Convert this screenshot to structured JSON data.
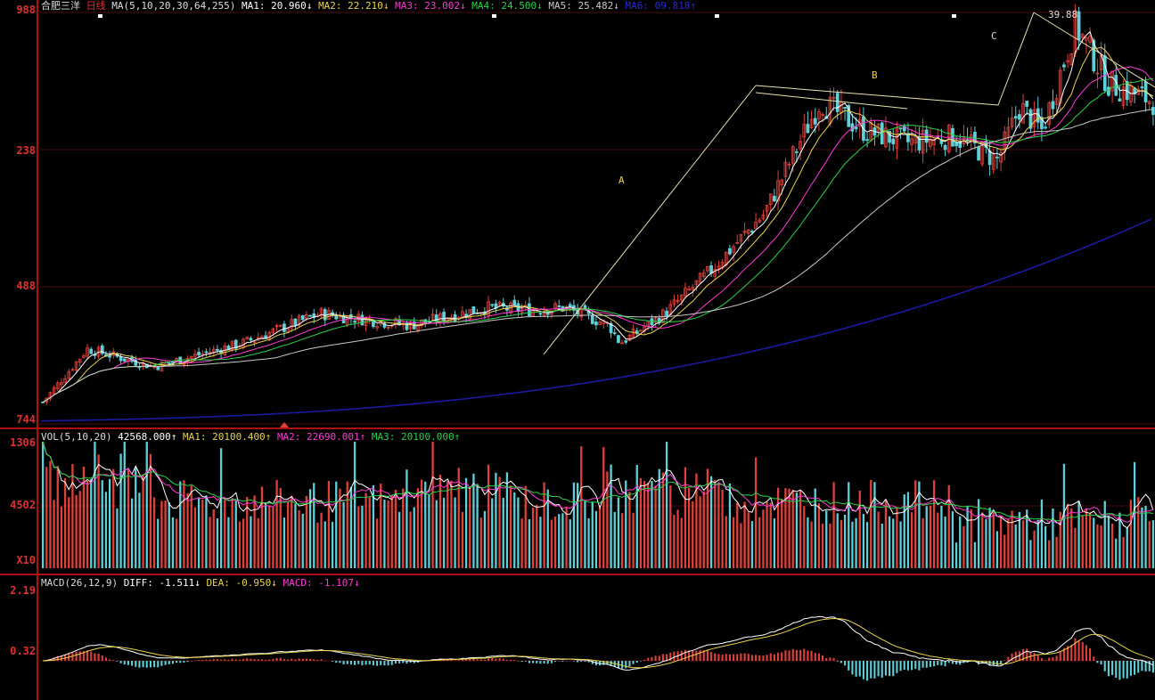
{
  "colors": {
    "background": "#000000",
    "frame": "#b01010",
    "grid": "#4a0b0b",
    "axis_text": "#e03030",
    "up_candle": "#e0413a",
    "down_candle": "#5fd0d8",
    "ma1": "#ffffff",
    "ma2": "#e8d44d",
    "ma3": "#ff3bd6",
    "ma4": "#2bd24a",
    "ma5": "#c8c8c8",
    "ma6": "#1a1aa0",
    "diff": "#ffffff",
    "dea": "#e8d44d"
  },
  "header": {
    "stock": "合肥三洋",
    "period": "日线",
    "ma_label": "MA(5,10,20,30,64,255)",
    "ma1": "MA1: 20.960↓",
    "ma2": "MA2: 22.210↓",
    "ma3": "MA3: 23.002↓",
    "ma4": "MA4: 24.500↓",
    "ma5": "MA5: 25.482↓",
    "ma6": "MA6: 09.818↑"
  },
  "volume_header": {
    "label": "VOL(5,10,20)",
    "value": "42568.000↑",
    "ma1": "MA1: 20100.400↑",
    "ma2": "MA2: 22690.001↑",
    "ma3": "MA3: 20100.000↑"
  },
  "macd_header": {
    "label": "MACD(26,12,9)",
    "diff": "DIFF: -1.511↓",
    "dea": "DEA: -0.950↓",
    "macd": "MACD: -1.107↓"
  },
  "annotations": {
    "a": "A",
    "b": "B",
    "c": "C",
    "peak": "39.88"
  },
  "chart_data": {
    "type": "candlestick",
    "panels": [
      {
        "name": "price",
        "y_ticks": [
          "988",
          "238",
          "488",
          "744"
        ],
        "ylim": [
          6.0,
          41.0
        ],
        "trendlines": "A, B, C",
        "price_path_x": [
          0,
          0.04,
          0.1,
          0.18,
          0.25,
          0.33,
          0.4,
          0.44,
          0.47,
          0.51,
          0.52,
          0.56,
          0.6,
          0.65,
          0.7,
          0.74,
          0.78,
          0.82,
          0.86,
          0.88,
          0.9,
          0.93,
          0.96,
          1.0
        ],
        "price_path_y": [
          8.0,
          12.5,
          11.0,
          13.0,
          15.5,
          14.5,
          16.0,
          15.8,
          16.0,
          14.5,
          13.0,
          15.5,
          19.0,
          24.0,
          33.5,
          31.0,
          30.0,
          30.5,
          28.5,
          33.0,
          31.0,
          39.9,
          35.0,
          33.5
        ]
      },
      {
        "name": "volume",
        "y_ticks": [
          "1306",
          "4502",
          "X10"
        ],
        "ylim": [
          0,
          100000
        ]
      },
      {
        "name": "macd",
        "y_ticks": [
          "2.19",
          "0.32"
        ],
        "ylim": [
          -1.8,
          2.4
        ]
      }
    ]
  }
}
